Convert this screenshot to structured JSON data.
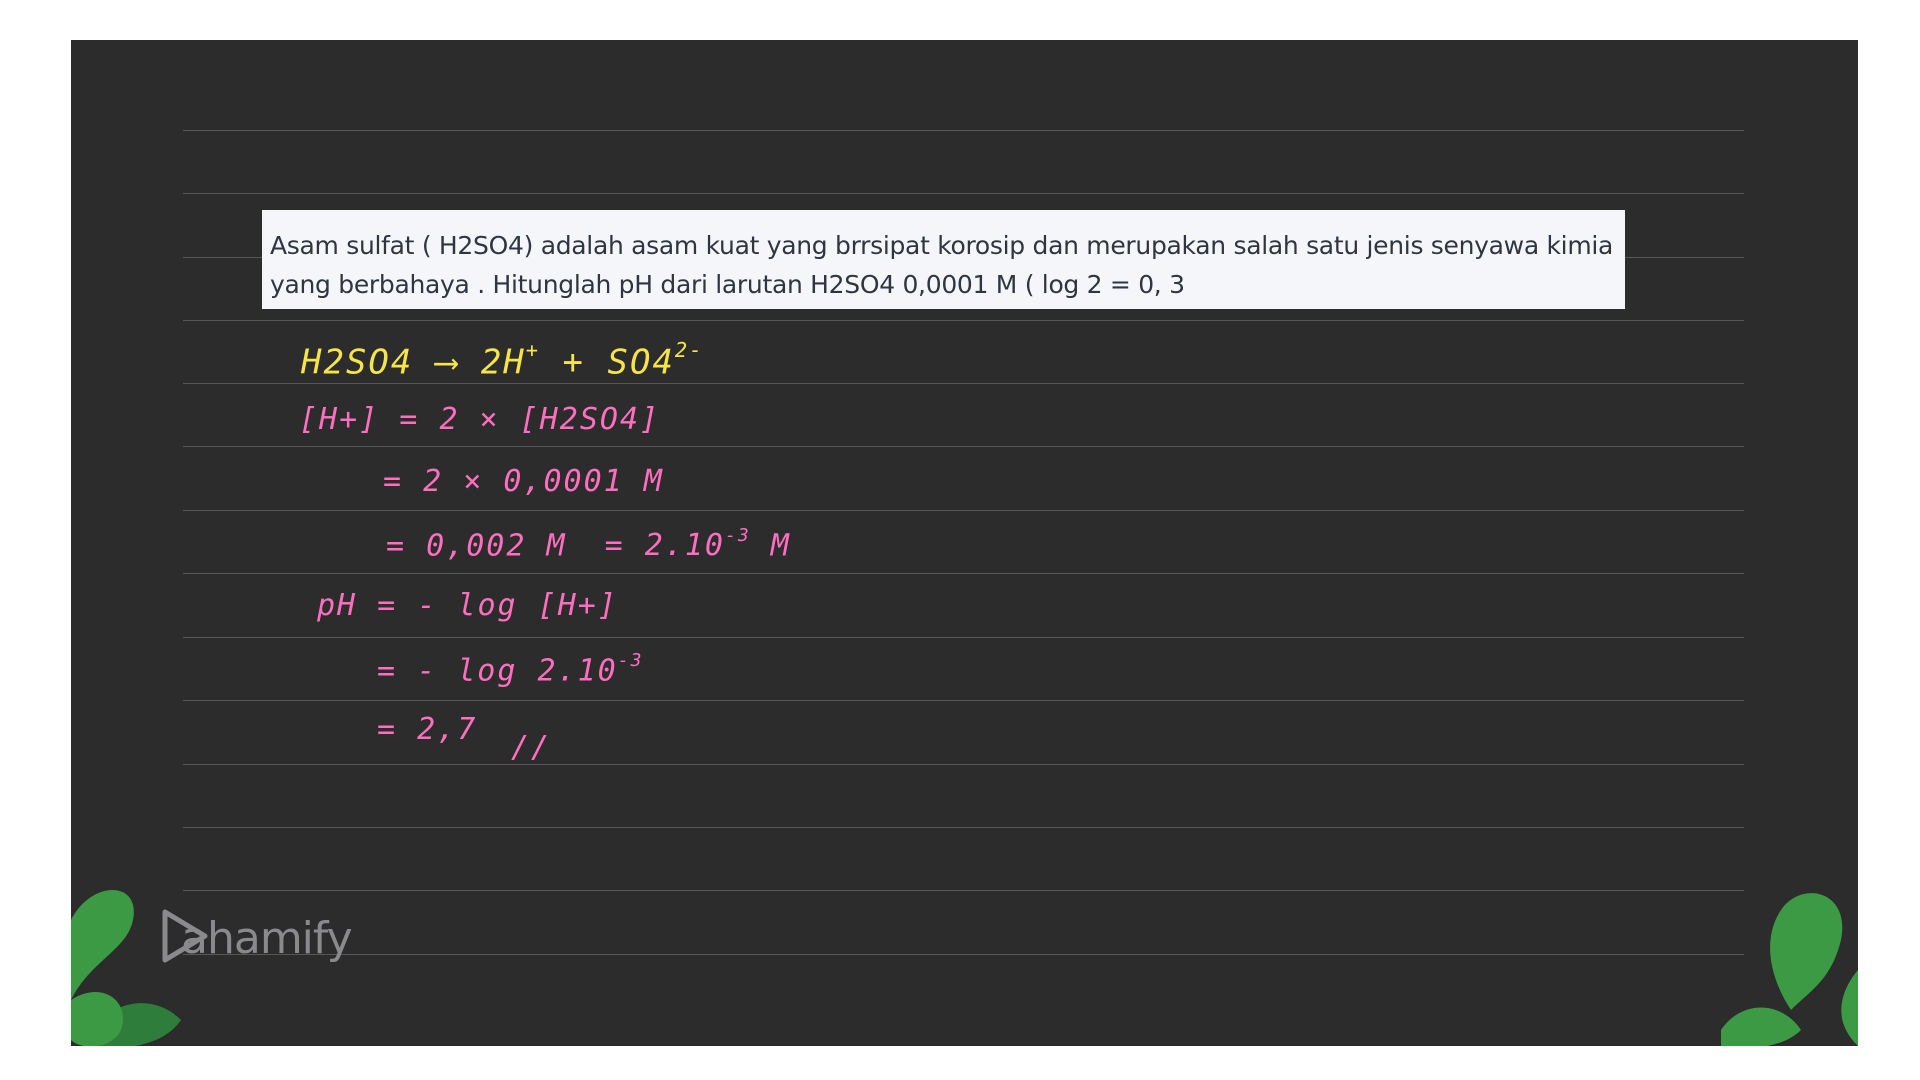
{
  "question": {
    "line1": "Asam sulfat ( H2SO4) adalah asam kuat yang brrsipat korosip dan merupakan salah satu jenis senyawa kimia",
    "line2": "yang berbahaya . Hitunglah pH dari larutan H2SO4 0,0001 M ( log 2 = 0,  3"
  },
  "solution": {
    "reaction": {
      "reactant": "H2SO4",
      "arrow": "⟶",
      "product1": "2H",
      "product1_charge": "+",
      "plus": "+",
      "product2": "SO4",
      "product2_charge": "2-"
    },
    "step1": {
      "lhs": "[H+] =",
      "rhs": "2 × [H2SO4]"
    },
    "step2": "= 2 × 0,0001 M",
    "step3": {
      "a": "= 0,002 M",
      "b": "= 2.10",
      "exp": "-3",
      "unit": "M"
    },
    "step4": {
      "lhs": "pH =",
      "rhs": "- log [H+]"
    },
    "step5": {
      "text": "= - log 2.10",
      "exp": "-3"
    },
    "step6": "= 2,7",
    "final_mark": "//"
  },
  "brand": {
    "name": "ahamify"
  },
  "colors": {
    "board": "#2c2c2d",
    "reaction_ink": "#f6e54a",
    "work_ink": "#ff6fbf",
    "leaf": "#3d9a44"
  }
}
